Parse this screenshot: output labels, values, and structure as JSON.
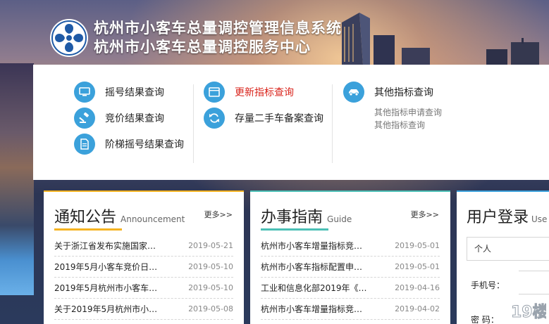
{
  "header": {
    "title_line1": "杭州市小客车总量调控管理信息系统",
    "title_line2": "杭州市小客车总量调控服务中心"
  },
  "quick_links": {
    "col1": [
      {
        "label": "摇号结果查询",
        "icon": "monitor-icon"
      },
      {
        "label": "竞价结果查询",
        "icon": "gavel-icon"
      },
      {
        "label": "阶梯摇号结果查询",
        "icon": "document-icon"
      }
    ],
    "col2": [
      {
        "label": "更新指标查询",
        "icon": "browser-window-icon",
        "highlight": "#d9231b"
      },
      {
        "label": "存量二手车备案查询",
        "icon": "refresh-icon"
      }
    ],
    "col3": {
      "label": "其他指标查询",
      "icon": "car-icon",
      "sublinks": [
        "其他指标申请查询",
        "其他指标查询"
      ]
    }
  },
  "notice": {
    "title": "通知公告",
    "subtitle": "Announcement",
    "more": "更多>>",
    "accent": "#f5b321",
    "items": [
      {
        "title": "关于浙江省发布实施国家…",
        "date": "2019-05-21"
      },
      {
        "title": "2019年5月小客车竞价日…",
        "date": "2019-05-10"
      },
      {
        "title": "2019年5月杭州市小客车…",
        "date": "2019-05-10"
      },
      {
        "title": "关于2019年5月杭州市小…",
        "date": "2019-05-08"
      }
    ]
  },
  "guide": {
    "title": "办事指南",
    "subtitle": "Guide",
    "more": "更多>>",
    "accent": "#4bbfb5",
    "items": [
      {
        "title": "杭州市小客车增量指标竞…",
        "date": "2019-05-01"
      },
      {
        "title": "杭州市小客车指标配置申…",
        "date": "2019-05-01"
      },
      {
        "title": "工业和信息化部2019年《…",
        "date": "2019-04-16"
      },
      {
        "title": "杭州市小客车增量指标竞…",
        "date": "2019-04-02"
      }
    ]
  },
  "login": {
    "title": "用户登录",
    "subtitle": "Use",
    "type_value": "个人",
    "phone_label": "手机号：",
    "password_label": "密 码："
  },
  "watermark": {
    "text": "19楼"
  }
}
